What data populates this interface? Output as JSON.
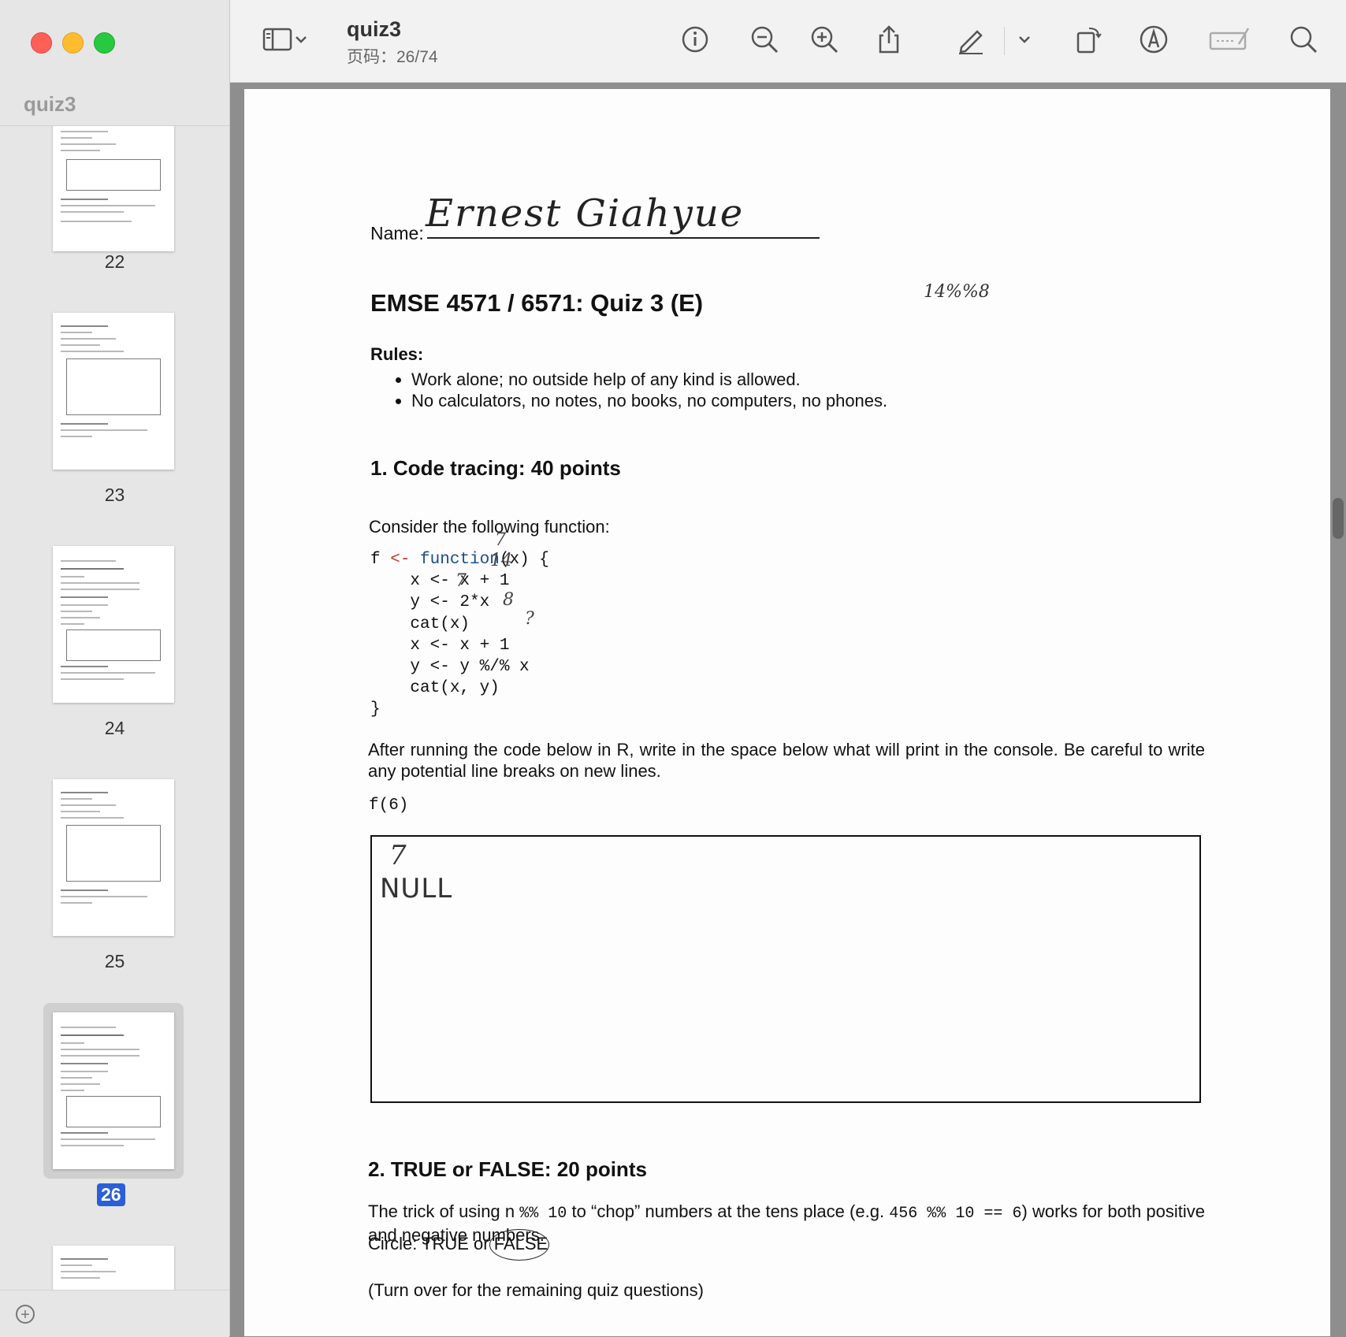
{
  "window": {
    "title": "quiz3",
    "page_indicator": "页码：26/74"
  },
  "sidebar": {
    "title": "quiz3",
    "thumbnails": [
      {
        "page": "22"
      },
      {
        "page": "23"
      },
      {
        "page": "24"
      },
      {
        "page": "25"
      },
      {
        "page": "26",
        "selected": true
      }
    ]
  },
  "toolbar": {
    "icons": [
      "sidebar-toggle-icon",
      "chevron-down-icon",
      "info-icon",
      "zoom-out-icon",
      "zoom-in-icon",
      "share-icon",
      "highlight-pen-icon",
      "chevron-down-icon",
      "rotate-icon",
      "markup-icon",
      "signature-icon",
      "search-icon"
    ]
  },
  "document": {
    "name_label": "Name:",
    "name_handwritten": "Ernest Giahyue",
    "score_handwritten": "14%%8",
    "title": "EMSE 4571 / 6571: Quiz 3 (E)",
    "rules_label": "Rules:",
    "rules": [
      "Work alone; no outside help of any kind is allowed.",
      "No calculators, no notes, no books, no computers, no phones."
    ],
    "q1_heading": "1. Code tracing: 40 points",
    "q1_consider": "Consider the following function:",
    "code_line1_a": "f ",
    "code_line1_op": "<-",
    "code_line1_kw": "function",
    "code_line1_b": "(x) {",
    "code_line2": "    x <- x + 1",
    "code_line3": "    y <- 2*x",
    "code_line4": "    cat(x)",
    "code_line5": "    x <- x + 1",
    "code_line6": "    y <- y %/% x",
    "code_line7": "    cat(x, y)",
    "code_line8": "}",
    "code_notes": [
      "7",
      "14",
      "7",
      "8",
      "?"
    ],
    "q1_instructions": "After running the code below in R, write in the space below what will print in the console. Be careful to write any potential line breaks on new lines.",
    "q1_call": "f(6)",
    "answer_line1": "7",
    "answer_line2": "NULL",
    "q2_heading": "2. TRUE or FALSE: 20 points",
    "q2_text_a": "The trick of using n ",
    "q2_code1": "%% 10",
    "q2_text_b": " to “chop” numbers at the tens place (e.g. ",
    "q2_code2": "456 %% 10 == 6",
    "q2_text_c": ") works for both positive and negative numbers.",
    "circle_label": "Circle: TRUE or ",
    "circle_choice": "FALSE",
    "footer_note": "(Turn over for the remaining quiz questions)"
  }
}
